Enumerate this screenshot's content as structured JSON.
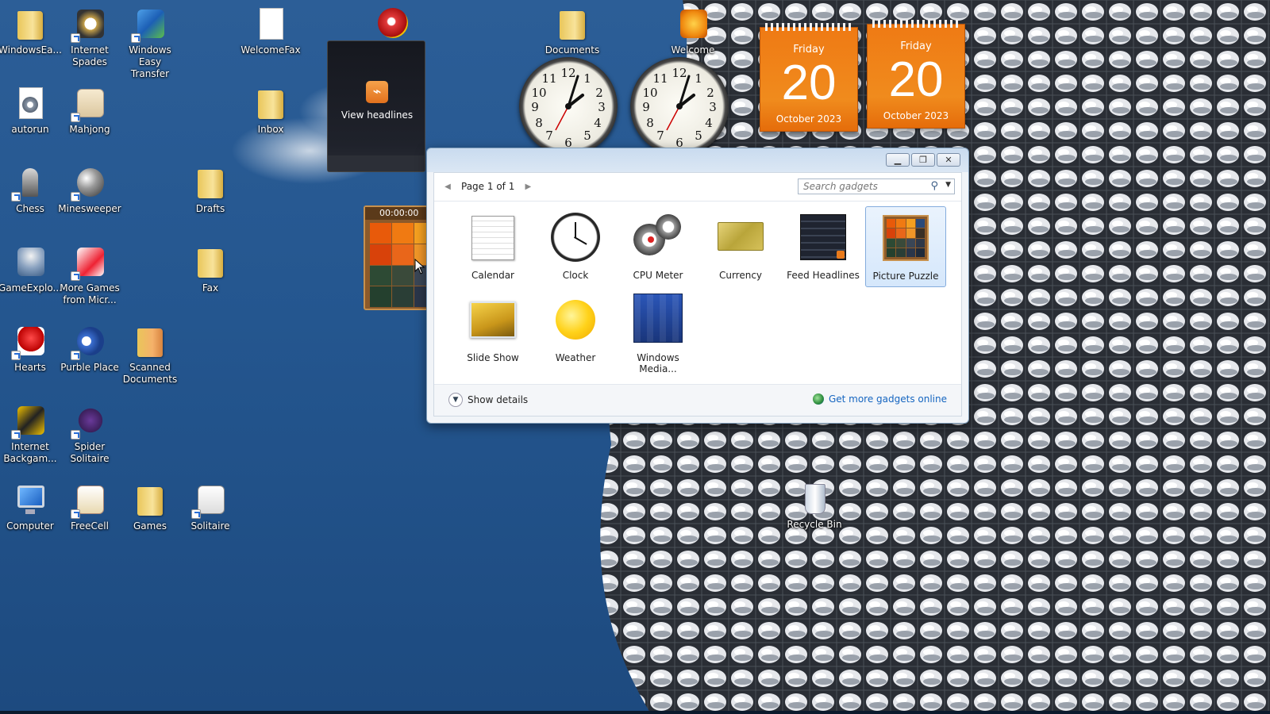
{
  "desktop_icons": [
    {
      "label": "WindowsEa...",
      "icon": "folder-icon"
    },
    {
      "label": "Internet Spades",
      "icon": "spades-icon"
    },
    {
      "label": "Windows Easy Transfer",
      "icon": "easy-transfer-icon"
    },
    {
      "label": "WelcomeFax",
      "icon": "document-icon"
    },
    {
      "label": "autorun",
      "icon": "settings-file-icon"
    },
    {
      "label": "Mahjong",
      "icon": "mahjong-icon"
    },
    {
      "label": "Inbox",
      "icon": "folder-icon"
    },
    {
      "label": "Chess",
      "icon": "chess-icon"
    },
    {
      "label": "Minesweeper",
      "icon": "minesweeper-icon"
    },
    {
      "label": "Drafts",
      "icon": "folder-icon"
    },
    {
      "label": "GameExplo...",
      "icon": "game-explorer-icon"
    },
    {
      "label": "More Games from Micr...",
      "icon": "more-games-icon"
    },
    {
      "label": "Fax",
      "icon": "folder-icon"
    },
    {
      "label": "Hearts",
      "icon": "hearts-icon"
    },
    {
      "label": "Purble Place",
      "icon": "purble-place-icon"
    },
    {
      "label": "Scanned Documents",
      "icon": "folder-icon"
    },
    {
      "label": "Internet Backgam...",
      "icon": "backgammon-icon"
    },
    {
      "label": "Spider Solitaire",
      "icon": "spider-solitaire-icon"
    },
    {
      "label": "Computer",
      "icon": "computer-icon"
    },
    {
      "label": "FreeCell",
      "icon": "freecell-icon"
    },
    {
      "label": "Games",
      "icon": "folder-icon"
    },
    {
      "label": "Solitaire",
      "icon": "solitaire-icon"
    },
    {
      "label": "Documents",
      "icon": "folder-icon"
    },
    {
      "label": "Welcome",
      "icon": "welcome-icon"
    },
    {
      "label": "Recycle Bin",
      "icon": "recycle-bin-icon"
    }
  ],
  "headlines_gadget": {
    "label": "View headlines"
  },
  "calendar_gadgets": [
    {
      "dow": "Friday",
      "day": "20",
      "month": "October 2023"
    },
    {
      "dow": "Friday",
      "day": "20",
      "month": "October 2023"
    }
  ],
  "puzzle_gadget": {
    "timer": "00:00:00"
  },
  "gallery": {
    "pager": "Page 1 of 1",
    "search_placeholder": "Search gadgets",
    "gadgets": [
      {
        "name": "Calendar"
      },
      {
        "name": "Clock"
      },
      {
        "name": "CPU Meter"
      },
      {
        "name": "Currency"
      },
      {
        "name": "Feed Headlines"
      },
      {
        "name": "Picture Puzzle"
      },
      {
        "name": "Slide Show"
      },
      {
        "name": "Weather"
      },
      {
        "name": "Windows Media..."
      }
    ],
    "selected": "Picture Puzzle",
    "show_details": "Show details",
    "get_more": "Get more gadgets online"
  },
  "colors": {
    "desktop_blue": "#24568f",
    "calendar_orange": "#f08b1d",
    "link_blue": "#1565c0"
  }
}
